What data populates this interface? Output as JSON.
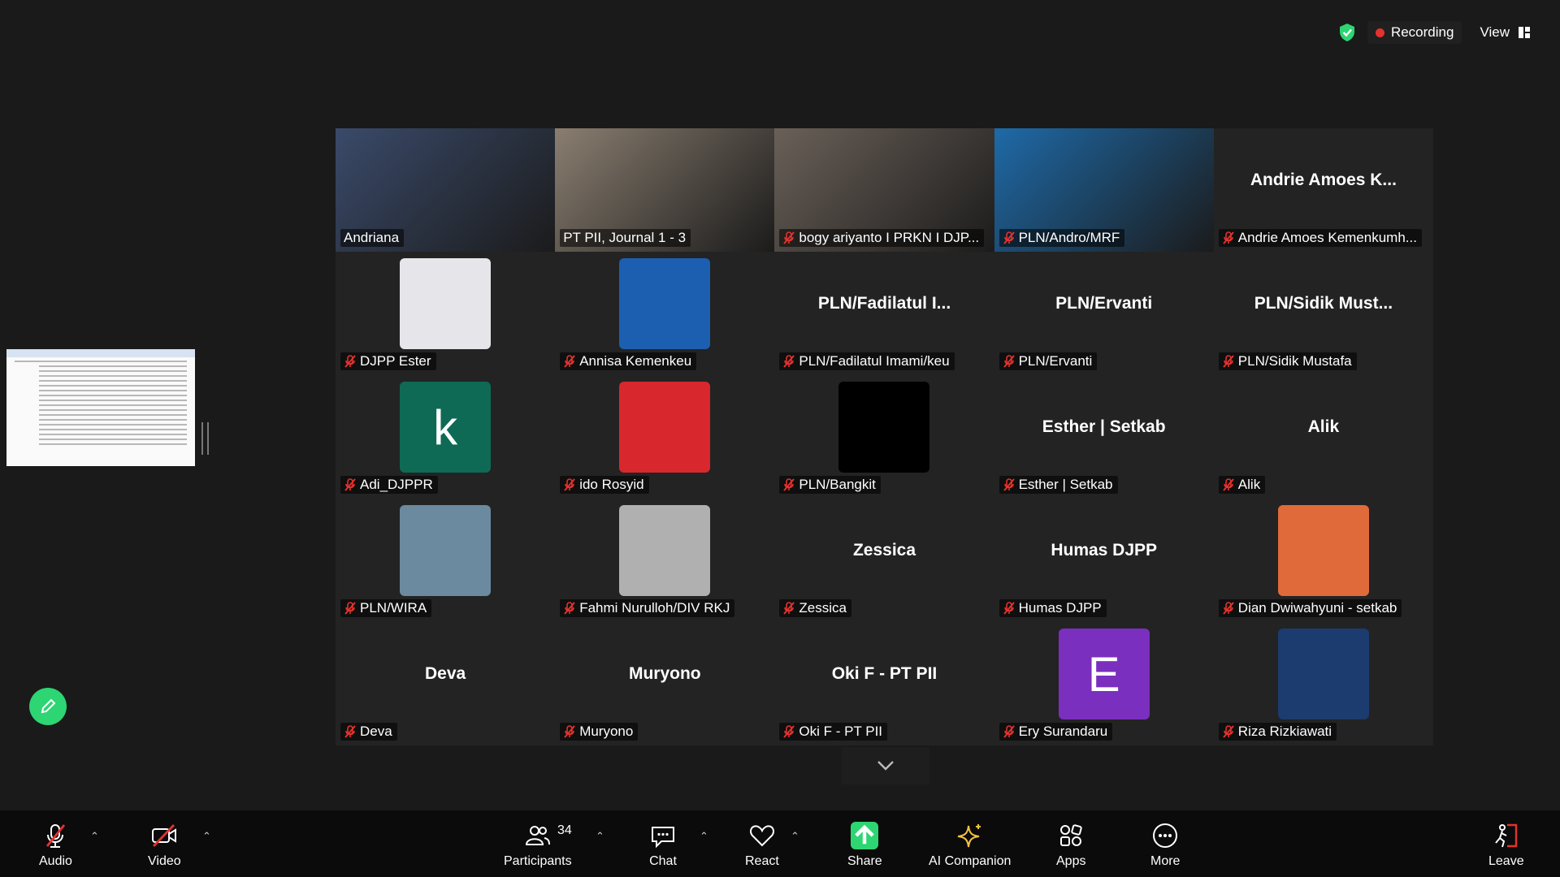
{
  "top_bar": {
    "recording_label": "Recording",
    "view_label": "View"
  },
  "tiles": [
    {
      "name": "Andriana",
      "kind": "video",
      "active": true,
      "bg": "#3a4a6a",
      "muted": false
    },
    {
      "name": "PT PII, Journal 1 - 3",
      "kind": "video",
      "bg": "#8a7e70",
      "muted": false
    },
    {
      "name": "bogy ariyanto I PRKN I DJP...",
      "kind": "video",
      "bg": "#6a6058",
      "muted": true
    },
    {
      "name": "PLN/Andro/MRF",
      "kind": "video",
      "bg": "#1e6aa8",
      "muted": true
    },
    {
      "name": "Andrie Amoes Kemenkumh...",
      "kind": "text",
      "big": "Andrie Amoes K...",
      "muted": true
    },
    {
      "name": "DJPP Ester",
      "kind": "avatar",
      "avatar_bg": "#e6e6ea",
      "muted": true
    },
    {
      "name": "Annisa Kemenkeu",
      "kind": "avatar",
      "avatar_bg": "#1c5fb0",
      "muted": true
    },
    {
      "name": "PLN/Fadilatul Imami/keu",
      "kind": "text",
      "big": "PLN/Fadilatul I...",
      "muted": true
    },
    {
      "name": "PLN/Ervanti",
      "kind": "text",
      "big": "PLN/Ervanti",
      "muted": true
    },
    {
      "name": "PLN/Sidik Mustafa",
      "kind": "text",
      "big": "PLN/Sidik Must...",
      "muted": true
    },
    {
      "name": "Adi_DJPPR",
      "kind": "avatar",
      "avatar_bg": "#0e6a55",
      "letter": "k",
      "muted": true
    },
    {
      "name": "ido Rosyid",
      "kind": "avatar",
      "avatar_bg": "#d8282d",
      "muted": true
    },
    {
      "name": "PLN/Bangkit",
      "kind": "avatar",
      "avatar_bg": "#000000",
      "muted": true
    },
    {
      "name": "Esther | Setkab",
      "kind": "text",
      "big": "Esther | Setkab",
      "muted": true
    },
    {
      "name": "Alik",
      "kind": "text",
      "big": "Alik",
      "muted": true
    },
    {
      "name": "PLN/WIRA",
      "kind": "avatar",
      "avatar_bg": "#6b8aa0",
      "muted": true
    },
    {
      "name": "Fahmi Nurulloh/DIV RKJ",
      "kind": "avatar",
      "avatar_bg": "#b0b0b0",
      "muted": true
    },
    {
      "name": "Zessica",
      "kind": "text",
      "big": "Zessica",
      "muted": true
    },
    {
      "name": "Humas DJPP",
      "kind": "text",
      "big": "Humas DJPP",
      "muted": true
    },
    {
      "name": "Dian Dwiwahyuni - setkab",
      "kind": "avatar",
      "avatar_bg": "#e06a3a",
      "muted": true
    },
    {
      "name": "Deva",
      "kind": "text",
      "big": "Deva",
      "muted": true
    },
    {
      "name": "Muryono",
      "kind": "text",
      "big": "Muryono",
      "muted": true
    },
    {
      "name": "Oki F - PT PII",
      "kind": "text",
      "big": "Oki F - PT PII",
      "muted": true
    },
    {
      "name": "Ery Surandaru",
      "kind": "avatar",
      "avatar_bg": "#7b2fbf",
      "letter": "E",
      "muted": true
    },
    {
      "name": "Riza Rizkiawati",
      "kind": "avatar",
      "avatar_bg": "#1c3b6e",
      "muted": true
    }
  ],
  "toolbar": {
    "audio_label": "Audio",
    "video_label": "Video",
    "participants_label": "Participants",
    "participants_count": "34",
    "chat_label": "Chat",
    "react_label": "React",
    "share_label": "Share",
    "ai_label": "AI Companion",
    "apps_label": "Apps",
    "more_label": "More",
    "leave_label": "Leave"
  }
}
